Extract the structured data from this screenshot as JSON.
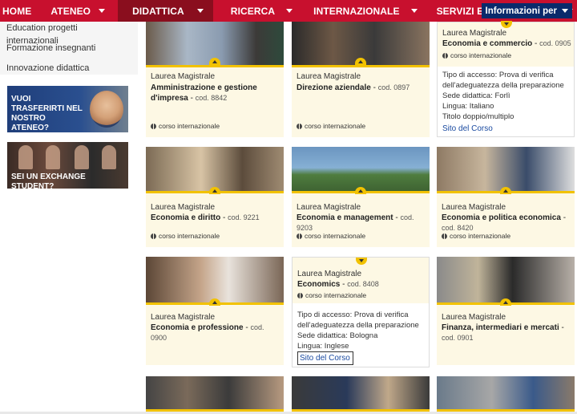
{
  "nav": {
    "items": [
      {
        "label": "HOME",
        "caret": false,
        "active": false
      },
      {
        "label": "ATENEO",
        "caret": true,
        "active": false
      },
      {
        "label": "DIDATTICA",
        "caret": true,
        "active": true
      },
      {
        "label": "RICERCA",
        "caret": true,
        "active": false
      },
      {
        "label": "INTERNAZIONALE",
        "caret": true,
        "active": false
      },
      {
        "label": "SERVIZI E OPPORTUNITÀ",
        "caret": true,
        "active": false
      }
    ],
    "info": "Informazioni per",
    "accent": "#c8102e",
    "active_bg": "#8a0e1e",
    "info_bg": "#0a2a6b"
  },
  "sidebar": {
    "links": [
      "Education progetti internazionali",
      "Formazione insegnanti",
      "Innovazione didattica"
    ],
    "banner1": "VUOI TRASFERIRTI NEL NOSTRO ATENEO?",
    "banner2": "SEI UN EXCHANGE STUDENT?"
  },
  "cards": [
    {
      "type": "Laurea Magistrale",
      "name": "Amministrazione e gestione d'impresa",
      "cod": "cod. 8842",
      "intl": "corso internazionale"
    },
    {
      "type": "Laurea Magistrale",
      "name": "Direzione aziendale",
      "cod": "cod. 0897",
      "intl": "corso internazionale"
    },
    {
      "type": "Laurea Magistrale",
      "name": "Economia e commercio",
      "cod": "cod. 0905",
      "intl": "corso internazionale",
      "details": [
        "Tipo di accesso: Prova di verifica dell'adeguatezza della preparazione",
        "Sede didattica: Forlì",
        "Lingua: Italiano",
        "Titolo doppio/multiplo"
      ],
      "sito": "Sito del Corso"
    },
    {
      "type": "Laurea Magistrale",
      "name": "Economia e diritto",
      "cod": "cod. 9221",
      "intl": "corso internazionale"
    },
    {
      "type": "Laurea Magistrale",
      "name": "Economia e management",
      "cod": "cod. 9203",
      "intl": "corso internazionale"
    },
    {
      "type": "Laurea Magistrale",
      "name": "Economia e politica economica",
      "cod": "cod. 8420",
      "intl": "corso internazionale"
    },
    {
      "type": "Laurea Magistrale",
      "name": "Economia e professione",
      "cod": "cod. 0900",
      "intl": ""
    },
    {
      "type": "Laurea Magistrale",
      "name": "Economics",
      "cod": "cod. 8408",
      "intl": "corso internazionale",
      "details": [
        "Tipo di accesso: Prova di verifica dell'adeguatezza della preparazione",
        "Sede didattica: Bologna",
        "Lingua: Inglese"
      ],
      "sito": "Sito del Corso"
    },
    {
      "type": "Laurea Magistrale",
      "name": "Finanza, intermediari e mercati",
      "cod": "cod. 0901",
      "intl": ""
    }
  ]
}
